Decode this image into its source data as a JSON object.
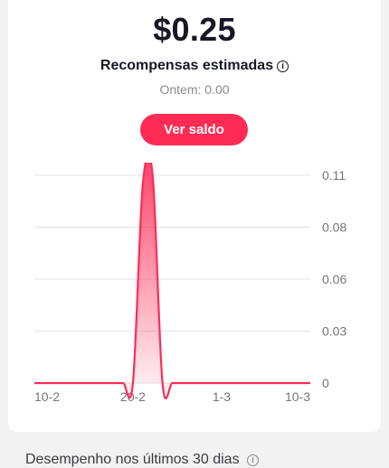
{
  "earnings": {
    "amount": "$0.25",
    "title": "Recompensas estimadas",
    "yesterday": "Ontem: 0.00",
    "button_label": "Ver saldo"
  },
  "chart_data": {
    "type": "area",
    "x_tick_labels": [
      "10-2",
      "20-2",
      "1-3",
      "10-3"
    ],
    "y_tick_labels": [
      "0.11",
      "0.08",
      "0.06",
      "0.03",
      "0"
    ],
    "ylim": [
      0,
      0.11
    ],
    "series": [
      {
        "x": [
          "10-2",
          "11-2",
          "12-2",
          "13-2",
          "14-2",
          "15-2",
          "16-2",
          "17-2",
          "18-2",
          "19-2",
          "20-2",
          "21-2",
          "22-2",
          "23-2",
          "24-2",
          "25-2",
          "26-2",
          "27-2",
          "28-2",
          "1-3",
          "2-3",
          "3-3",
          "4-3",
          "5-3",
          "6-3",
          "7-3",
          "8-3",
          "9-3",
          "10-3"
        ],
        "values": [
          0,
          0,
          0,
          0,
          0,
          0,
          0,
          0,
          0,
          0,
          0,
          0.105,
          0.11,
          0,
          0,
          0,
          0,
          0,
          0,
          0,
          0,
          0,
          0,
          0,
          0,
          0,
          0,
          0,
          0
        ]
      }
    ],
    "grid": true,
    "color": "#fe2c55"
  },
  "performance": {
    "title": "Desempenho nos últimos 30 dias"
  },
  "icons": {
    "info": "info-icon"
  }
}
